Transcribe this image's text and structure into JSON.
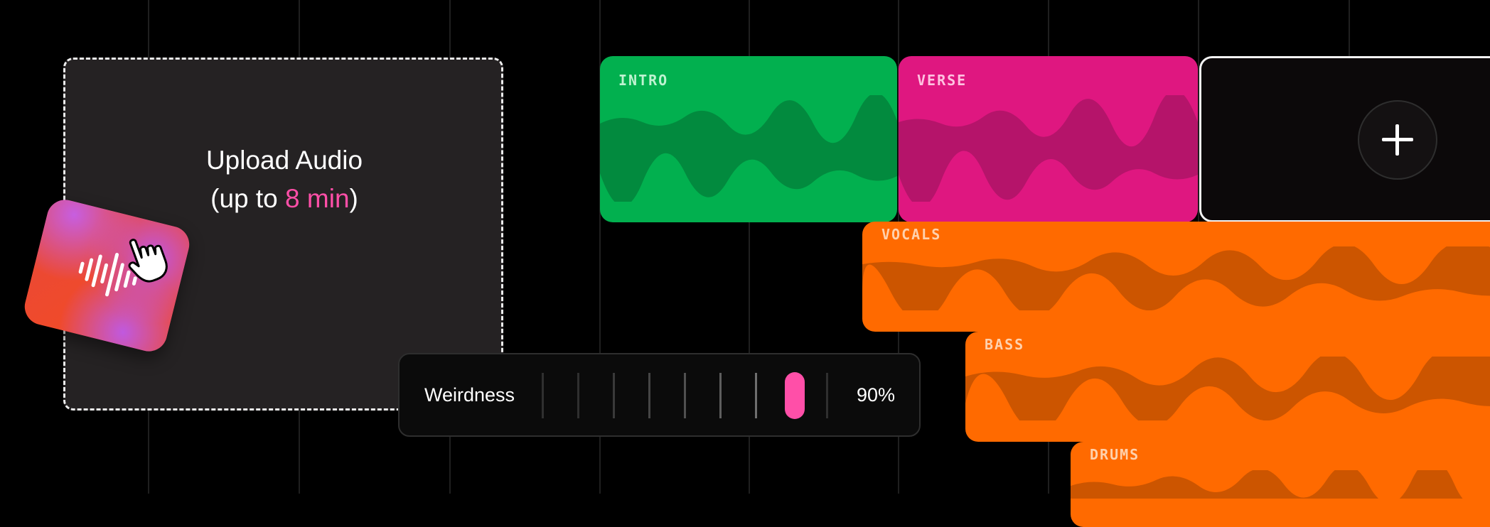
{
  "upload": {
    "title": "Upload Audio",
    "subtitle_prefix": "(up to ",
    "subtitle_limit": "8 min",
    "subtitle_suffix": ")",
    "accent_color": "#ff4fa8"
  },
  "icons": {
    "app": "audio-waveform-app-icon",
    "cursor": "hand-pointer-icon",
    "add": "plus-icon"
  },
  "tracks": {
    "intro": {
      "label": "INTRO",
      "color": "#02b04f"
    },
    "verse": {
      "label": "VERSE",
      "color": "#df1780"
    },
    "vocals": {
      "label": "VOCALS",
      "color": "#ff6a00"
    },
    "bass": {
      "label": "BASS",
      "color": "#ff6a00"
    },
    "drums": {
      "label": "DRUMS",
      "color": "#ff6a00"
    }
  },
  "weirdness": {
    "label": "Weirdness",
    "value_text": "90%",
    "value": 0.9,
    "thumb_color": "#ff4fa8"
  }
}
